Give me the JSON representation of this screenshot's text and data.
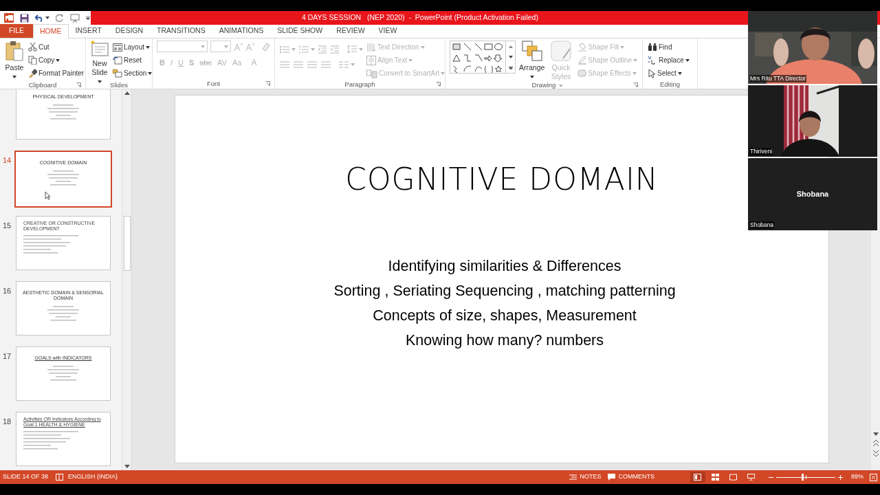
{
  "window": {
    "title": "4 DAYS SESSION   (NEP 2020)  -  PowerPoint (Product Activation Failed)"
  },
  "tabs": [
    {
      "label": "FILE",
      "kind": "file",
      "selected": false
    },
    {
      "label": "HOME",
      "kind": "tab",
      "selected": true
    },
    {
      "label": "INSERT",
      "kind": "tab",
      "selected": false
    },
    {
      "label": "DESIGN",
      "kind": "tab",
      "selected": false
    },
    {
      "label": "TRANSITIONS",
      "kind": "tab",
      "selected": false
    },
    {
      "label": "ANIMATIONS",
      "kind": "tab",
      "selected": false
    },
    {
      "label": "SLIDE SHOW",
      "kind": "tab",
      "selected": false
    },
    {
      "label": "REVIEW",
      "kind": "tab",
      "selected": false
    },
    {
      "label": "VIEW",
      "kind": "tab",
      "selected": false
    }
  ],
  "ribbon": [
    {
      "label": "Clipboard",
      "kind": "buttons",
      "items": [
        {
          "label": "Paste",
          "kind": "large",
          "disabled": false,
          "dropdown": true
        },
        {
          "label": "Cut",
          "kind": "small",
          "disabled": false,
          "dropdown": false
        },
        {
          "label": "Copy",
          "kind": "small",
          "disabled": false,
          "dropdown": true
        },
        {
          "label": "Format Painter",
          "kind": "small",
          "disabled": false,
          "dropdown": false
        }
      ]
    },
    {
      "label": "Slides",
      "kind": "buttons",
      "items": [
        {
          "label": "New Slide",
          "kind": "large",
          "disabled": false,
          "dropdown": true
        },
        {
          "label": "Layout",
          "kind": "small",
          "disabled": false,
          "dropdown": true
        },
        {
          "label": "Reset",
          "kind": "small",
          "disabled": false,
          "dropdown": false
        },
        {
          "label": "Section",
          "kind": "small",
          "disabled": false,
          "dropdown": true
        }
      ]
    },
    {
      "label": "Font",
      "kind": "font",
      "disabled": true,
      "glyphs": [
        "B",
        "I",
        "U",
        "S",
        "abc",
        "AV",
        "Aa",
        "A"
      ]
    },
    {
      "label": "Paragraph",
      "kind": "paragraph",
      "items": [
        {
          "label": "Text Direction",
          "kind": "small",
          "disabled": true,
          "dropdown": true
        },
        {
          "label": "Align Text",
          "kind": "small",
          "disabled": true,
          "dropdown": true
        },
        {
          "label": "Convert to SmartArt",
          "kind": "small",
          "disabled": true,
          "dropdown": true
        }
      ]
    },
    {
      "label": "Drawing",
      "kind": "drawing",
      "items": [
        {
          "label": "Arrange",
          "kind": "large",
          "disabled": false,
          "dropdown": true
        },
        {
          "label": "Quick Styles",
          "kind": "large",
          "disabled": true,
          "dropdown": true
        },
        {
          "label": "Shape Fill",
          "kind": "small",
          "disabled": true,
          "dropdown": true
        },
        {
          "label": "Shape Outline",
          "kind": "small",
          "disabled": true,
          "dropdown": true
        },
        {
          "label": "Shape Effects",
          "kind": "small",
          "disabled": true,
          "dropdown": true
        }
      ]
    },
    {
      "label": "Editing",
      "kind": "buttons",
      "items": [
        {
          "label": "Find",
          "kind": "small",
          "disabled": false,
          "dropdown": false
        },
        {
          "label": "Replace",
          "kind": "small",
          "disabled": false,
          "dropdown": true
        },
        {
          "label": "Select",
          "kind": "small",
          "disabled": false,
          "dropdown": true
        }
      ]
    }
  ],
  "thumbnails": [
    {
      "selected": false,
      "kind": "centered",
      "title": "PHYSICAL DEVELOPMENT",
      "underlined": false
    },
    {
      "number": "14",
      "selected": true,
      "kind": "centered",
      "title": "COGNITIVE DOMAIN",
      "underlined": false
    },
    {
      "number": "15",
      "selected": false,
      "kind": "list",
      "title": "CREATIVE OR CONSTRUCTIVE DEVELOPMENT",
      "underlined": false
    },
    {
      "number": "16",
      "selected": false,
      "kind": "centered",
      "title": "AESTHETIC DOMAIN & SENSORIAL DOMAIN",
      "underlined": false
    },
    {
      "number": "17",
      "selected": false,
      "kind": "centered",
      "title": "GOALS with INDICATORS",
      "underlined": true
    },
    {
      "number": "18",
      "selected": false,
      "kind": "list",
      "title": "Activities OR Indicators According to Goal 1 HEALTH & HYGIENE",
      "underlined": true
    }
  ],
  "slide": {
    "title": "COGNITIVE DOMAIN",
    "lines": [
      "Identifying similarities & Differences",
      "Sorting , Seriating Sequencing , matching patterning",
      "Concepts of size, shapes, Measurement",
      "Knowing how many? numbers"
    ]
  },
  "video_tiles": [
    {
      "name": "Mrs Ritu TTA Director",
      "kind": "video_full"
    },
    {
      "name": "Thiriveni",
      "kind": "video_narrow"
    },
    {
      "name": "Shobana",
      "kind": "avatar",
      "display_name": "Shobana"
    }
  ],
  "status_bar": {
    "slide_indicator": "SLIDE 14 OF 38",
    "language": "ENGLISH (INDIA)",
    "notes": "NOTES",
    "comments": "COMMENTS",
    "views": [
      {
        "selected": true
      },
      {
        "selected": false
      },
      {
        "selected": false
      },
      {
        "selected": false
      }
    ],
    "zoom": {
      "level": 0.45,
      "reading": "89%"
    }
  }
}
